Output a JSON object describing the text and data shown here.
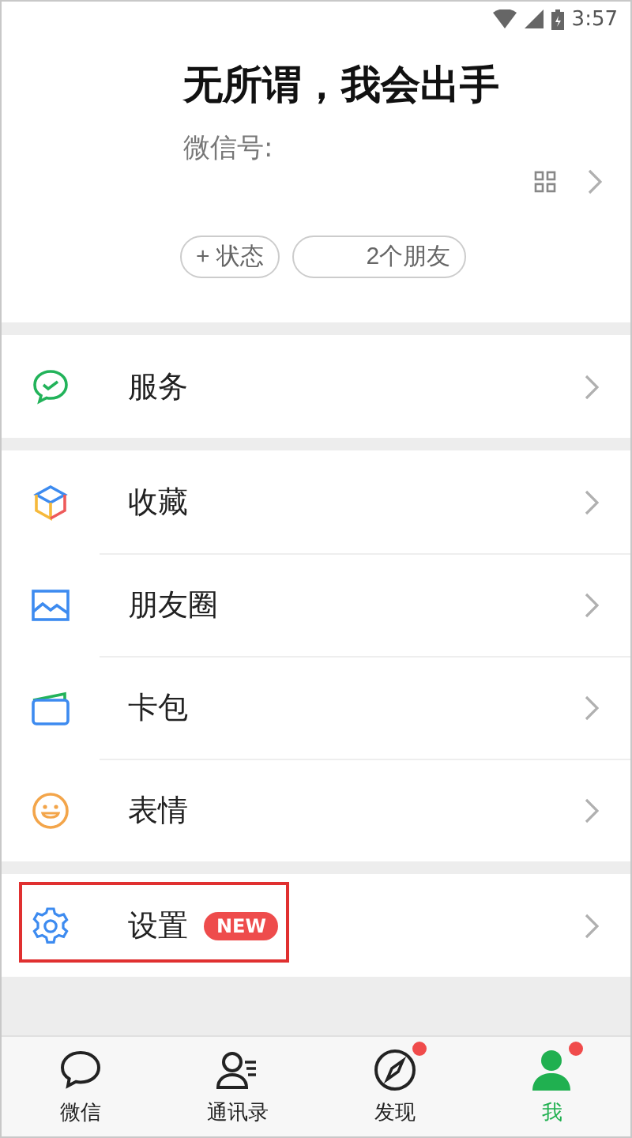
{
  "status_bar": {
    "time": "3:57"
  },
  "profile": {
    "name": "无所谓，我会出手",
    "wechat_id_label": "微信号:",
    "chips": [
      {
        "kind": "status",
        "icon": "+",
        "label": "状态"
      },
      {
        "kind": "friends",
        "label": "2个朋友"
      }
    ]
  },
  "menu_groups": [
    {
      "items": [
        {
          "kind": "service",
          "label": "服务",
          "highlighted": false
        }
      ]
    },
    {
      "items": [
        {
          "kind": "favorites",
          "label": "收藏",
          "highlighted": false
        },
        {
          "kind": "moments",
          "label": "朋友圈",
          "highlighted": false
        },
        {
          "kind": "cards",
          "label": "卡包",
          "highlighted": false
        },
        {
          "kind": "stickers",
          "label": "表情",
          "highlighted": false
        }
      ]
    },
    {
      "items": [
        {
          "kind": "settings",
          "label": "设置",
          "badge": "NEW",
          "highlighted": true
        }
      ]
    }
  ],
  "tab_bar": [
    {
      "kind": "chat",
      "label": "微信",
      "selected": false,
      "dot": false
    },
    {
      "kind": "contacts",
      "label": "通讯录",
      "selected": false,
      "dot": false
    },
    {
      "kind": "discover",
      "label": "发现",
      "selected": false,
      "dot": true
    },
    {
      "kind": "me",
      "label": "我",
      "selected": true,
      "dot": true
    }
  ]
}
